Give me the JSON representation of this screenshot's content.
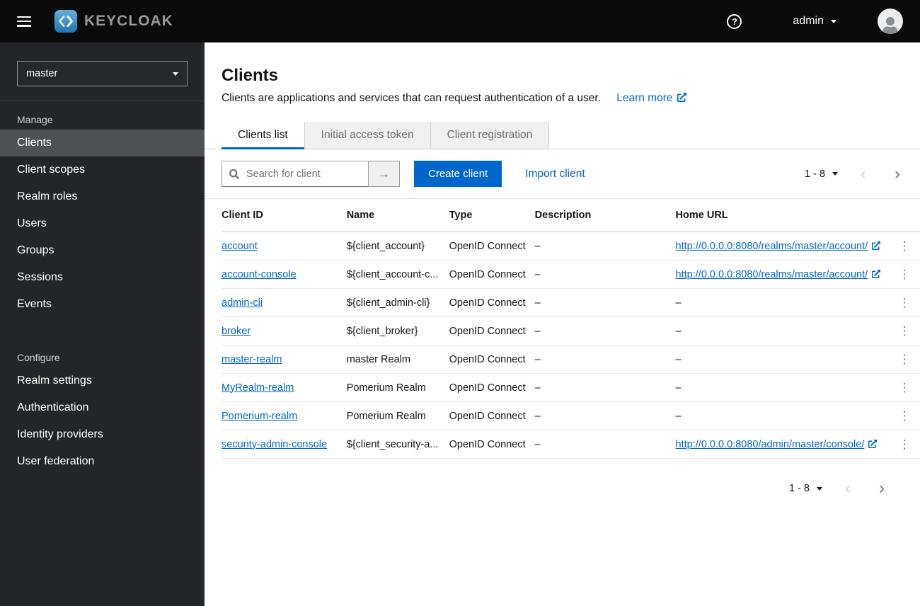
{
  "topbar": {
    "brand": "KEYCLOAK",
    "username": "admin"
  },
  "sidebar": {
    "realm": "master",
    "selected_item": "Clients",
    "groups": [
      {
        "label": "Manage",
        "items": [
          "Clients",
          "Client scopes",
          "Realm roles",
          "Users",
          "Groups",
          "Sessions",
          "Events"
        ]
      },
      {
        "label": "Configure",
        "items": [
          "Realm settings",
          "Authentication",
          "Identity providers",
          "User federation"
        ]
      }
    ]
  },
  "page": {
    "title": "Clients",
    "description": "Clients are applications and services that can request authentication of a user.",
    "learn_more": "Learn more"
  },
  "tabs": [
    {
      "label": "Clients list",
      "active": true
    },
    {
      "label": "Initial access token",
      "active": false
    },
    {
      "label": "Client registration",
      "active": false
    }
  ],
  "toolbar": {
    "search_placeholder": "Search for client",
    "create_label": "Create client",
    "import_label": "Import client",
    "pagination": "1 - 8"
  },
  "table": {
    "columns": [
      "Client ID",
      "Name",
      "Type",
      "Description",
      "Home URL"
    ],
    "rows": [
      {
        "client_id": "account",
        "name": "${client_account}",
        "type": "OpenID Connect",
        "description": "–",
        "home_url": "http://0.0.0.0:8080/realms/master/account/"
      },
      {
        "client_id": "account-console",
        "name": "${client_account-c...",
        "type": "OpenID Connect",
        "description": "–",
        "home_url": "http://0.0.0.0:8080/realms/master/account/"
      },
      {
        "client_id": "admin-cli",
        "name": "${client_admin-cli}",
        "type": "OpenID Connect",
        "description": "–",
        "home_url": "–"
      },
      {
        "client_id": "broker",
        "name": "${client_broker}",
        "type": "OpenID Connect",
        "description": "–",
        "home_url": "–"
      },
      {
        "client_id": "master-realm",
        "name": "master Realm",
        "type": "OpenID Connect",
        "description": "–",
        "home_url": "–"
      },
      {
        "client_id": "MyRealm-realm",
        "name": "Pomerium Realm",
        "type": "OpenID Connect",
        "description": "–",
        "home_url": "–"
      },
      {
        "client_id": "Pomerium-realm",
        "name": "Pomerium Realm",
        "type": "OpenID Connect",
        "description": "–",
        "home_url": "–"
      },
      {
        "client_id": "security-admin-console",
        "name": "${client_security-a...",
        "type": "OpenID Connect",
        "description": "–",
        "home_url": "http://0.0.0.0:8080/admin/master/console/"
      }
    ]
  },
  "pagination_bottom": "1 - 8",
  "icons": {
    "hamburger": "css-bars",
    "help": "?",
    "chevron_down": "css-triangle",
    "arrow_right": "→",
    "chevron_left": "‹",
    "chevron_right": "›",
    "kebab": "⋮",
    "external_link": "svg-external-link-arrow",
    "search": "svg-magnifier",
    "avatar": "svg-person"
  },
  "colors": {
    "accent": "#0066cc",
    "link": "#0066cc",
    "masthead": "#0a0a0a",
    "sidebar": "#232528",
    "sidebar_selected": "#4f5255",
    "tab_inactive_bg": "#f0f0f0"
  }
}
